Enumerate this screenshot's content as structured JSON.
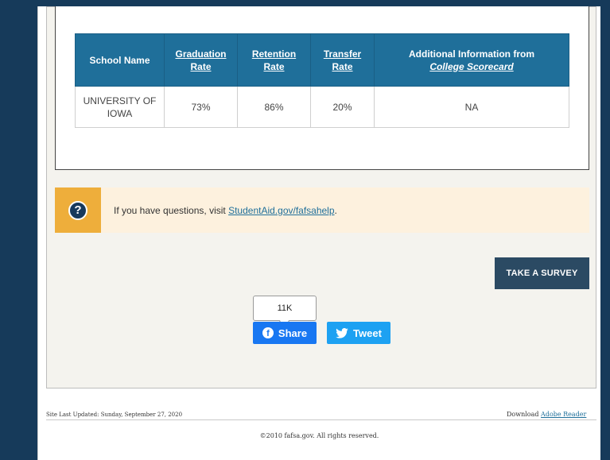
{
  "table": {
    "headers": {
      "school_name": "School Name",
      "graduation_line1": "Graduation",
      "graduation_line2": "Rate",
      "retention_line1": "Retention",
      "retention_line2": "Rate",
      "transfer_line1": "Transfer",
      "transfer_line2": "Rate",
      "additional_line1": "Additional Information from",
      "additional_line2": "College Scorecard"
    },
    "rows": [
      {
        "school_line1": "UNIVERSITY OF",
        "school_line2": "IOWA",
        "graduation": "73%",
        "retention": "86%",
        "transfer": "20%",
        "additional": "NA"
      }
    ]
  },
  "help": {
    "icon": "question-icon",
    "text": "If you have questions, visit",
    "link": "StudentAid.gov/fafsahelp",
    "suffix": "."
  },
  "survey_button": "TAKE A SURVEY",
  "social": {
    "share_count": "11K",
    "facebook_label": "Share",
    "twitter_label": "Tweet"
  },
  "footer": {
    "updated": "Site Last Updated: Sunday, September 27, 2020",
    "download_prefix": "Download",
    "download_link": "Adobe Reader",
    "copyright": "©2010 fafsa.gov. All rights reserved."
  },
  "colors": {
    "frame": "#163a5a",
    "table_header": "#1f6f9a",
    "help_accent": "#eeae3b",
    "survey_button": "#2b4a63",
    "facebook": "#1877f2",
    "twitter": "#1da1f2"
  }
}
